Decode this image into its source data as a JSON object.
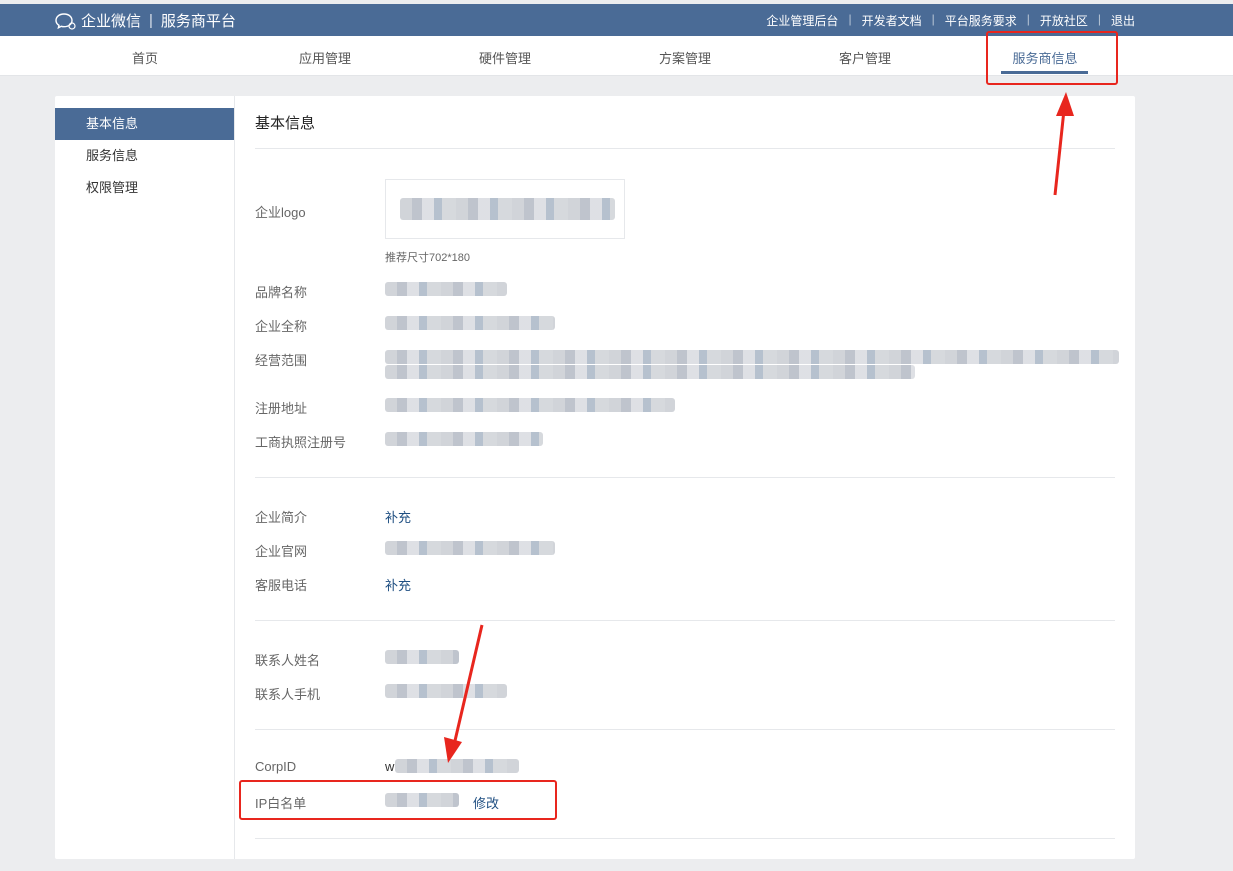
{
  "header": {
    "brand_name": "企业微信",
    "platform_name": "服务商平台",
    "links": [
      "企业管理后台",
      "开发者文档",
      "平台服务要求",
      "开放社区",
      "退出"
    ],
    "bg_color": "#4a6b96"
  },
  "nav": {
    "items": [
      "首页",
      "应用管理",
      "硬件管理",
      "方案管理",
      "客户管理",
      "服务商信息"
    ],
    "active": "服务商信息"
  },
  "sidebar": {
    "items": [
      "基本信息",
      "服务信息",
      "权限管理"
    ],
    "active": "基本信息"
  },
  "main": {
    "title": "基本信息",
    "logo": {
      "label": "企业logo",
      "hint": "推荐尺寸702*180"
    },
    "fields_basic": [
      {
        "label": "品牌名称"
      },
      {
        "label": "企业全称"
      },
      {
        "label": "经营范围"
      },
      {
        "label": "注册地址"
      },
      {
        "label": "工商执照注册号"
      }
    ],
    "fields_profile": [
      {
        "label": "企业简介",
        "action": "补充"
      },
      {
        "label": "企业官网"
      },
      {
        "label": "客服电话",
        "action": "补充"
      }
    ],
    "fields_contact": [
      {
        "label": "联系人姓名"
      },
      {
        "label": "联系人手机"
      }
    ],
    "fields_ids": [
      {
        "label": "CorpID",
        "value_prefix": "w"
      },
      {
        "label": "IP白名单",
        "action": "修改"
      }
    ]
  },
  "annotations": {
    "color": "#e8261e"
  }
}
